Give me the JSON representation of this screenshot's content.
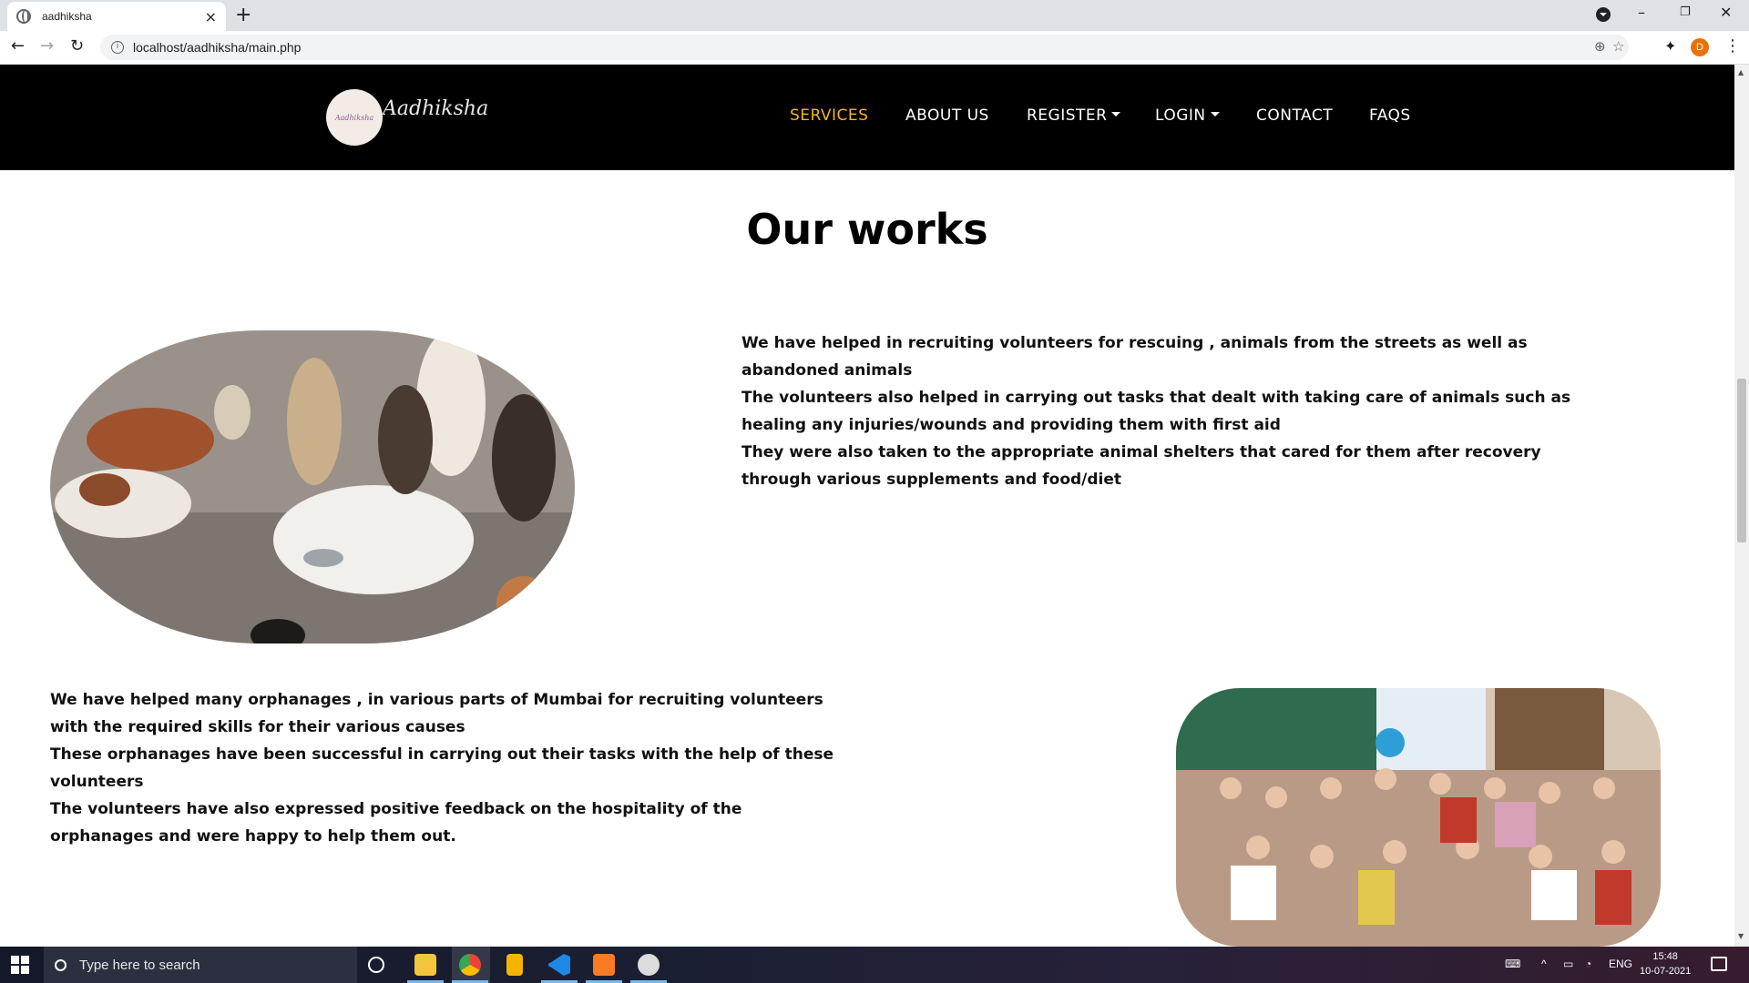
{
  "browser": {
    "tab_title": "aadhiksha",
    "tab_close": "×",
    "new_tab": "+",
    "url": "localhost/aadhiksha/main.php",
    "window_controls": {
      "minimize": "–",
      "restore": "❐",
      "close": "✕"
    },
    "back": "←",
    "forward": "→",
    "reload": "↻",
    "zoom_icon": "⊕",
    "star_icon": "☆",
    "extensions_icon": "✦",
    "profile_initial": "D",
    "menu": "⋮"
  },
  "site": {
    "brand": "Aadhiksha",
    "logo_text": "Aadhiksha",
    "nav": {
      "services": "SERVICES",
      "about": "ABOUT US",
      "register": "REGISTER",
      "login": "LOGIN",
      "contact": "CONTACT",
      "faqs": "FAQS"
    },
    "accent_color": "#f4b41a",
    "heading": "Our works",
    "section1": {
      "line1": "We have helped in recruiting volunteers for rescuing , animals from the streets as well as abandoned animals",
      "line2": "The volunteers also helped in carrying out tasks that dealt with taking care of animals such as healing any injuries/wounds and providing them with first aid",
      "line3": "They were also taken to the appropriate animal shelters that cared for them after recovery through various supplements and food/diet"
    },
    "section2": {
      "line1": "We have helped many orphanages , in various parts of Mumbai for recruiting volunteers with the required skills for their various causes",
      "line2": "These orphanages have been successful in carrying out their tasks with the help of these volunteers",
      "line3": "The volunteers have also expressed positive feedback on the hospitality of the orphanages and were happy to help them out."
    }
  },
  "taskbar": {
    "search_placeholder": "Type here to search",
    "tray_lang": "ENG",
    "tray_up": "^",
    "time": "15:48",
    "date": "10-07-2021"
  }
}
